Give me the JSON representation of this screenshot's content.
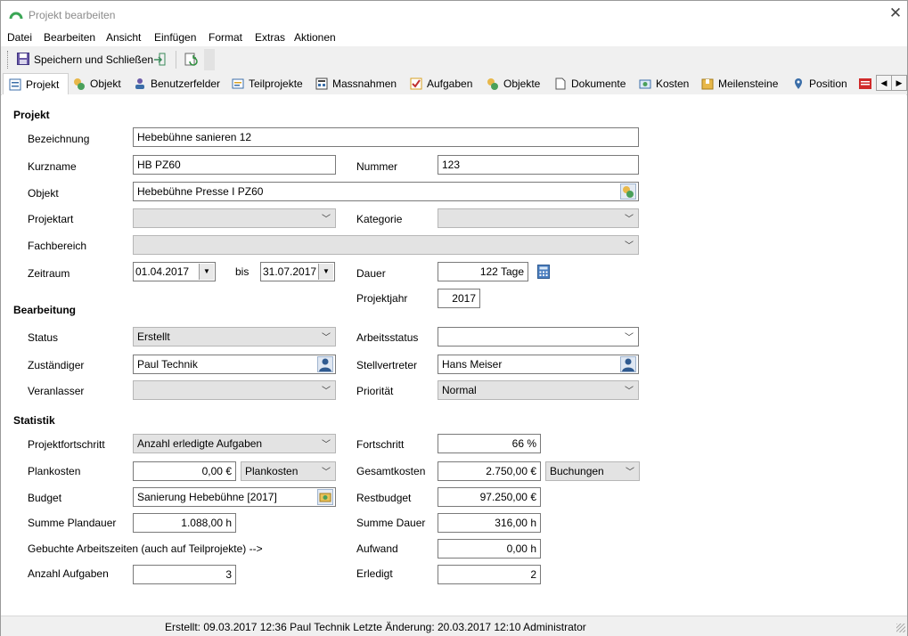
{
  "window": {
    "title": "Projekt bearbeiten"
  },
  "menu": [
    "Datei",
    "Bearbeiten",
    "Ansicht",
    "Einfügen",
    "Format",
    "Extras",
    "Aktionen"
  ],
  "toolbar": {
    "save_close_label": "Speichern und Schließen"
  },
  "tabs": [
    "Projekt",
    "Objekt",
    "Benutzerfelder",
    "Teilprojekte",
    "Massnahmen",
    "Aufgaben",
    "Objekte",
    "Dokumente",
    "Kosten",
    "Meilensteine",
    "Position"
  ],
  "sections": {
    "projekt": "Projekt",
    "bearbeitung": "Bearbeitung",
    "statistik": "Statistik"
  },
  "projekt": {
    "bezeichnung_label": "Bezeichnung",
    "bezeichnung_value": "Hebebühne sanieren 12",
    "kurzname_label": "Kurzname",
    "kurzname_value": "HB PZ60",
    "nummer_label": "Nummer",
    "nummer_value": "123",
    "objekt_label": "Objekt",
    "objekt_value": "Hebebühne Presse I PZ60",
    "projektart_label": "Projektart",
    "projektart_value": "",
    "kategorie_label": "Kategorie",
    "kategorie_value": "",
    "fachbereich_label": "Fachbereich",
    "fachbereich_value": "",
    "zeitraum_label": "Zeitraum",
    "zeitraum_from": "01.04.2017",
    "bis_label": "bis",
    "zeitraum_to": "31.07.2017",
    "dauer_label": "Dauer",
    "dauer_value": "122 Tage",
    "projektjahr_label": "Projektjahr",
    "projektjahr_value": "2017"
  },
  "bearbeitung": {
    "status_label": "Status",
    "status_value": "Erstellt",
    "arbeitsstatus_label": "Arbeitsstatus",
    "arbeitsstatus_value": "",
    "zustaendiger_label": "Zuständiger",
    "zustaendiger_value": "Paul Technik",
    "stellvertreter_label": "Stellvertreter",
    "stellvertreter_value": "Hans Meiser",
    "veranlasser_label": "Veranlasser",
    "veranlasser_value": "",
    "prioritaet_label": "Priorität",
    "prioritaet_value": "Normal"
  },
  "statistik": {
    "projektfortschritt_label": "Projektfortschritt",
    "projektfortschritt_value": "Anzahl erledigte Aufgaben",
    "fortschritt_label": "Fortschritt",
    "fortschritt_value": "66 %",
    "plankosten_label": "Plankosten",
    "plankosten_value": "0,00 €",
    "plankosten_select": "Plankosten",
    "gesamtkosten_label": "Gesamtkosten",
    "gesamtkosten_value": "2.750,00 €",
    "gesamtkosten_select": "Buchungen",
    "budget_label": "Budget",
    "budget_value": "Sanierung Hebebühne [2017]",
    "restbudget_label": "Restbudget",
    "restbudget_value": "97.250,00 €",
    "summe_plandauer_label": "Summe Plandauer",
    "summe_plandauer_value": "1.088,00 h",
    "summe_dauer_label": "Summe Dauer",
    "summe_dauer_value": "316,00 h",
    "gebuchte_label": "Gebuchte Arbeitszeiten (auch auf Teilprojekte) -->",
    "aufwand_label": "Aufwand",
    "aufwand_value": "0,00 h",
    "anzahl_aufgaben_label": "Anzahl Aufgaben",
    "anzahl_aufgaben_value": "3",
    "erledigt_label": "Erledigt",
    "erledigt_value": "2"
  },
  "statusbar": {
    "text": "Erstellt: 09.03.2017 12:36 Paul Technik  Letzte Änderung: 20.03.2017 12:10 Administrator"
  }
}
